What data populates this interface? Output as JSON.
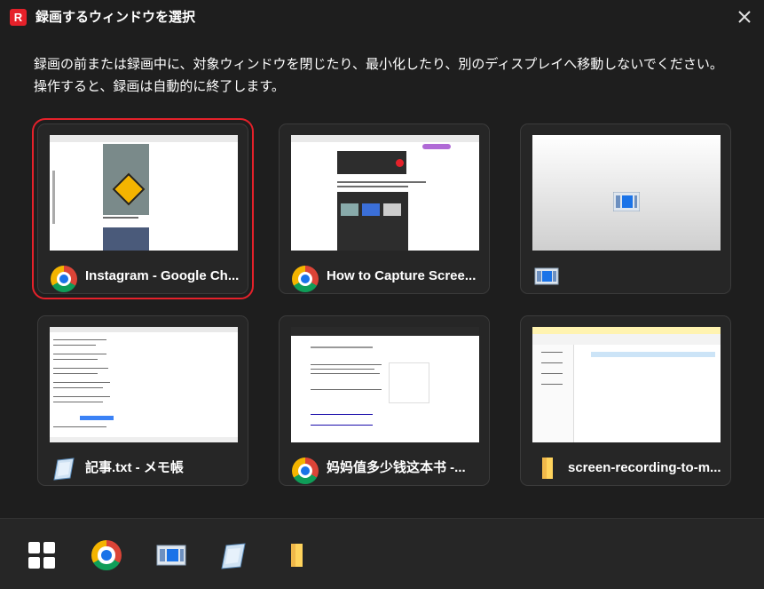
{
  "window": {
    "title": "録画するウィンドウを選択",
    "description": "録画の前または録画中に、対象ウィンドウを閉じたり、最小化したり、別のディスプレイへ移動しないでください。操作すると、録画は自動的に終了します。"
  },
  "cards": [
    {
      "label": "Instagram - Google Ch...",
      "icon": "chrome-icon",
      "selected": true
    },
    {
      "label": "How to Capture Scree...",
      "icon": "chrome-icon",
      "selected": false
    },
    {
      "label": "",
      "icon": "app-window-icon",
      "selected": false
    },
    {
      "label": "記事.txt - メモ帳",
      "icon": "notepad-icon",
      "selected": false
    },
    {
      "label": "妈妈值多少钱这本书 -...",
      "icon": "chrome-icon",
      "selected": false
    },
    {
      "label": "screen-recording-to-m...",
      "icon": "folder-icon",
      "selected": false
    }
  ],
  "taskbar": {
    "icons": [
      "grid-icon",
      "chrome-icon",
      "app-window-icon",
      "notepad-icon",
      "folder-icon"
    ]
  },
  "colors": {
    "background": "#1e1e1e",
    "card": "#262626",
    "selection": "#e5212a",
    "accent_blue": "#1a73e8"
  }
}
